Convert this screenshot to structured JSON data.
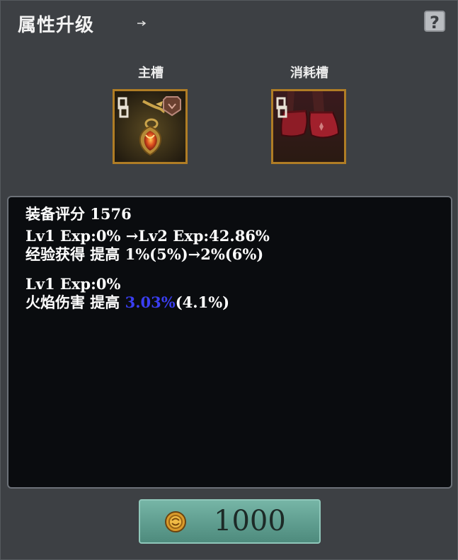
{
  "header": {
    "title": "属性升级",
    "help_icon_glyph": "?"
  },
  "slots": {
    "main_label": "主槽",
    "consume_label": "消耗槽",
    "main_item_icon": "amulet-icon",
    "consume_item_icon": "red-boots-icon"
  },
  "info": {
    "score": "装备评分 1576",
    "line1": "Lv1 Exp:0% →Lv2 Exp:42.86%",
    "line2": "经验获得 提高 1%(5%)→2%(6%)",
    "line3": "Lv1 Exp:0%",
    "line4_prefix": "火焰伤害 提高 ",
    "line4_highlight": "3.03%",
    "line4_suffix": "(4.1%)"
  },
  "cost_button": {
    "icon": "gold-coin-icon",
    "amount": "1000"
  },
  "colors": {
    "panel_bg": "#3d4044",
    "info_bg": "#0a0c0f",
    "highlight": "#3a3ef0",
    "slot_border": "#b07d25",
    "button": "#5f9d8f"
  }
}
